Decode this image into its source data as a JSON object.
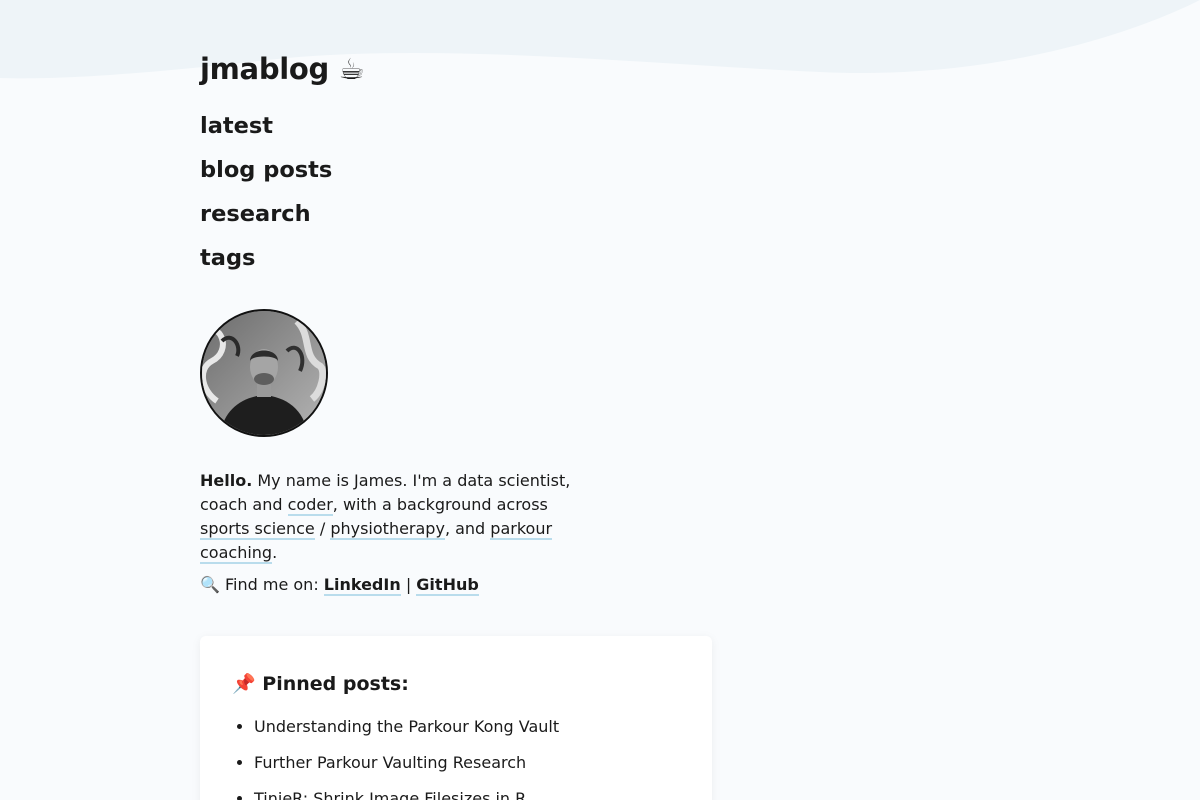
{
  "site": {
    "title": "jmablog ☕"
  },
  "nav": [
    {
      "label": "latest"
    },
    {
      "label": "blog posts"
    },
    {
      "label": "research"
    },
    {
      "label": "tags"
    }
  ],
  "intro": {
    "hello": "Hello.",
    "t1": " My name is James. I'm a data scientist, coach and ",
    "coder": "coder",
    "t2": ", with a background across ",
    "sports_science": "sports science",
    "t3": " / ",
    "physiotherapy": "physiotherapy",
    "t4": ", and ",
    "parkour_coaching": "parkour coaching",
    "t5": "."
  },
  "find": {
    "label": "🔍 Find me on: ",
    "linkedin": "LinkedIn",
    "sep": " | ",
    "github": "GitHub"
  },
  "pinned": {
    "heading": "📌 Pinned posts:",
    "items": [
      {
        "label": "Understanding the Parkour Kong Vault"
      },
      {
        "label": "Further Parkour Vaulting Research"
      },
      {
        "label": "TinieR: Shrink Image Filesizes in R"
      }
    ]
  },
  "colors": {
    "background": "#f9fbfd",
    "wave": "#eef4f8",
    "link_underline": "#b9dcec"
  }
}
